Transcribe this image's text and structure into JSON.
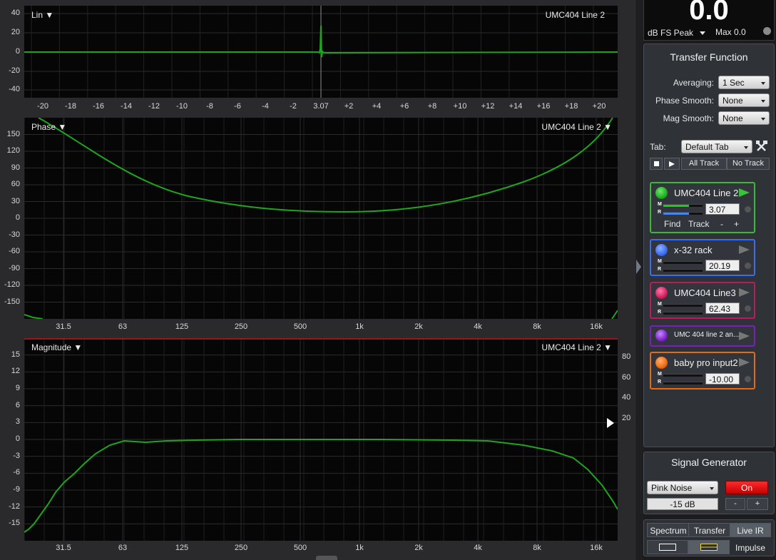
{
  "plots": {
    "ir": {
      "name": "Lin ▼",
      "track": "UMC404 Line 2",
      "y_ticks": [
        "40",
        "20",
        "0",
        "-20",
        "-40"
      ],
      "x_ticks": [
        "-20",
        "-18",
        "-16",
        "-14",
        "-12",
        "-10",
        "-8",
        "-6",
        "-4",
        "-2",
        "3.07",
        "+2",
        "+4",
        "+6",
        "+8",
        "+10",
        "+12",
        "+14",
        "+16",
        "+18",
        "+20"
      ]
    },
    "phase": {
      "name": "Phase ▼",
      "track": "UMC404 Line 2 ▼",
      "y_ticks": [
        "150",
        "120",
        "90",
        "60",
        "30",
        "0",
        "-30",
        "-60",
        "-90",
        "-120",
        "-150"
      ],
      "x_ticks": [
        "31.5",
        "63",
        "125",
        "250",
        "500",
        "1k",
        "2k",
        "4k",
        "8k",
        "16k"
      ]
    },
    "magnitude": {
      "name": "Magnitude ▼",
      "track": "UMC404 Line 2 ▼",
      "y_ticks": [
        "15",
        "12",
        "9",
        "6",
        "3",
        "0",
        "-3",
        "-6",
        "-9",
        "-12",
        "-15"
      ],
      "right_ticks": [
        "80",
        "60",
        "40",
        "20"
      ],
      "x_ticks": [
        "31.5",
        "63",
        "125",
        "250",
        "500",
        "1k",
        "2k",
        "4k",
        "8k",
        "16k"
      ]
    }
  },
  "meter": {
    "value": "0.0",
    "label": "dB FS Peak",
    "max": "Max 0.0"
  },
  "transfer": {
    "title": "Transfer Function",
    "averaging_label": "Averaging:",
    "averaging_value": "1 Sec",
    "phase_smooth_label": "Phase Smooth:",
    "phase_smooth_value": "None",
    "mag_smooth_label": "Mag Smooth:",
    "mag_smooth_value": "None",
    "tab_label": "Tab:",
    "tab_value": "Default Tab",
    "all_track": "All Track",
    "no_track": "No Track"
  },
  "tracks": [
    {
      "name": "UMC404 Line 2",
      "delay": "3.07",
      "color": "#1fae1f",
      "border": "#2fbf2f",
      "find": "Find",
      "track": "Track",
      "minus": "-",
      "plus": "+"
    },
    {
      "name": "x-32 rack",
      "delay": "20.19",
      "color": "#3a6cf0",
      "border": "#3a6cf0"
    },
    {
      "name": "UMC404 Line3",
      "delay": "62.43",
      "color": "#d0205e",
      "border": "#c2185b"
    },
    {
      "name": "UMC 404 line 2 an...",
      "color": "#7e22c9",
      "border": "#7a1fbf"
    },
    {
      "name": "baby pro input2",
      "delay": "-10.00",
      "color": "#f06a10",
      "border": "#e86a10"
    }
  ],
  "generator": {
    "title": "Signal Generator",
    "type": "Pink Noise",
    "on": "On",
    "level": "-15 dB",
    "minus": "-",
    "plus": "+"
  },
  "tabs": {
    "spectrum": "Spectrum",
    "transfer": "Transfer",
    "live_ir": "Live IR",
    "impulse": "Impulse"
  }
}
